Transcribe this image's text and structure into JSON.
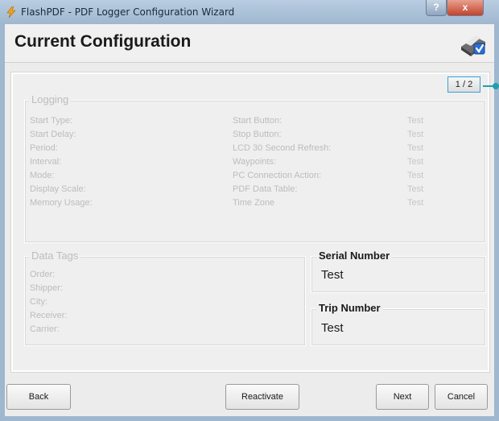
{
  "window": {
    "title": "FlashPDF - PDF Logger Configuration Wizard",
    "help_label": "?",
    "close_label": "x"
  },
  "header": {
    "title": "Current Configuration"
  },
  "page_indicator": "1 / 2",
  "logging": {
    "legend": "Logging",
    "left": [
      {
        "label": "Start Type:"
      },
      {
        "label": "Start Delay:"
      },
      {
        "label": "Period:"
      },
      {
        "label": "Interval:"
      },
      {
        "label": "Mode:"
      },
      {
        "label": "Display Scale:"
      },
      {
        "label": "Memory Usage:"
      }
    ],
    "right": [
      {
        "label": "Start Button:",
        "value": "Test"
      },
      {
        "label": "Stop Button:",
        "value": "Test"
      },
      {
        "label": "LCD 30 Second Refresh:",
        "value": "Test"
      },
      {
        "label": "Waypoints:",
        "value": "Test"
      },
      {
        "label": "PC Connection Action:",
        "value": "Test"
      },
      {
        "label": "PDF Data Table:",
        "value": "Test"
      },
      {
        "label": "Time Zone",
        "value": "Test"
      }
    ]
  },
  "data_tags": {
    "legend": "Data Tags",
    "fields": [
      {
        "label": "Order:"
      },
      {
        "label": "Shipper:"
      },
      {
        "label": "City:"
      },
      {
        "label": "Receiver:"
      },
      {
        "label": "Carrier:"
      }
    ]
  },
  "serial_number": {
    "legend": "Serial Number",
    "value": "Test"
  },
  "trip_number": {
    "legend": "Trip Number",
    "value": "Test"
  },
  "buttons": {
    "back": "Back",
    "reactivate": "Reactivate",
    "next": "Next",
    "cancel": "Cancel"
  }
}
